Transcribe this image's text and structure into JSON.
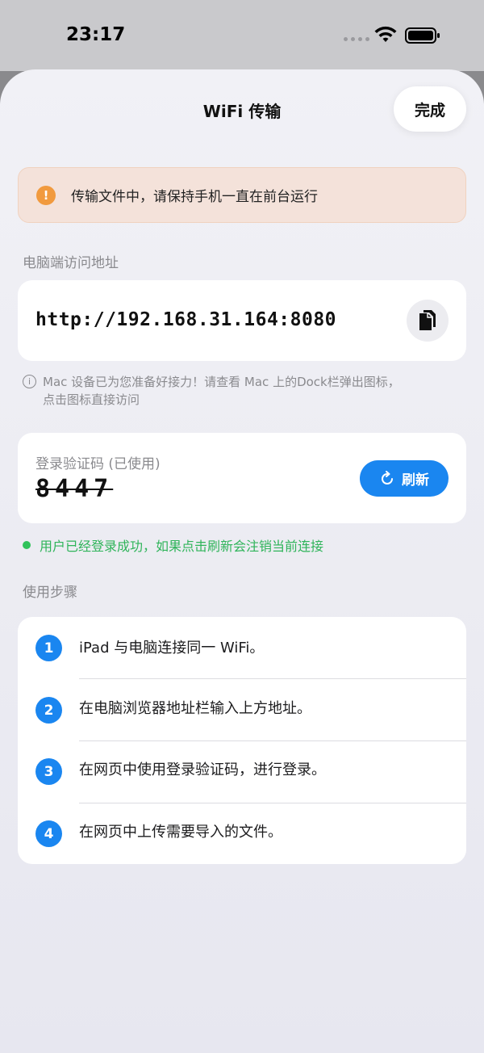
{
  "status_bar": {
    "time": "23:17"
  },
  "header": {
    "title": "WiFi 传输",
    "done_label": "完成"
  },
  "warning": {
    "icon": "!",
    "text": "传输文件中，请保持手机一直在前台运行"
  },
  "address_section": {
    "label": "电脑端访问地址",
    "address": "http://192.168.31.164:8080",
    "hint_icon": "i",
    "hint_line1": "Mac 设备已为您准备好接力！请查看 Mac 上的Dock栏弹出图标，",
    "hint_line2": "点击图标直接访问"
  },
  "login_code": {
    "label": "登录验证码 (已使用)",
    "code": "8447",
    "refresh_label": "刷新",
    "status_text": "用户已经登录成功，如果点击刷新会注销当前连接"
  },
  "steps": {
    "label": "使用步骤",
    "items": [
      {
        "num": "1",
        "text": "iPad 与电脑连接同一 WiFi。"
      },
      {
        "num": "2",
        "text": "在电脑浏览器地址栏输入上方地址。"
      },
      {
        "num": "3",
        "text": "在网页中使用登录验证码，进行登录。"
      },
      {
        "num": "4",
        "text": "在网页中上传需要导入的文件。"
      }
    ]
  },
  "colors": {
    "accent": "#1a86f0",
    "warning": "#f19a3e",
    "success": "#30c25a"
  }
}
